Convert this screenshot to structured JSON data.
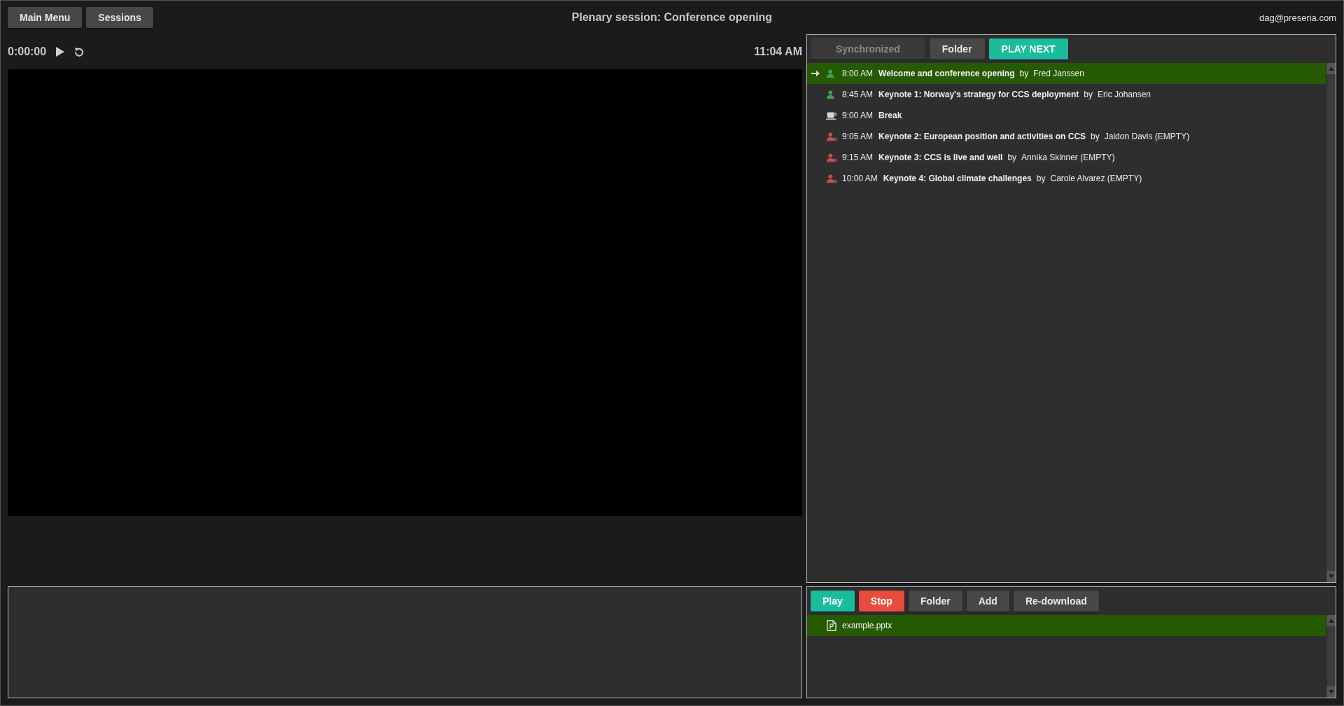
{
  "header": {
    "buttons": [
      "Main Menu",
      "Sessions"
    ],
    "title": "Plenary session: Conference opening",
    "user": "dag@preseria.com"
  },
  "player": {
    "time": "0:00:00",
    "clock": "11:04 AM"
  },
  "sessions": {
    "buttons": [
      {
        "label": "Synchronized",
        "kind": "normal",
        "disabled": true
      },
      {
        "label": "Folder",
        "kind": "normal",
        "disabled": false
      },
      {
        "label": "PLAY NEXT",
        "kind": "primary",
        "disabled": false
      }
    ],
    "items": [
      {
        "time": "8:00 AM",
        "title": "Welcome and conference opening",
        "by": "by",
        "presenter": "Fred Janssen",
        "kind": "speaker",
        "current": true,
        "selected": true
      },
      {
        "time": "8:45 AM",
        "title": "Keynote 1: Norway's strategy for CCS deployment",
        "by": "by",
        "presenter": "Eric Johansen",
        "kind": "speaker",
        "current": false,
        "selected": false
      },
      {
        "time": "9:00 AM",
        "title": "Break",
        "kind": "break",
        "current": false,
        "selected": false
      },
      {
        "time": "9:05 AM",
        "title": "Keynote 2: European position and activities on CCS",
        "by": "by",
        "presenter": "Jaidon Davis (EMPTY)",
        "kind": "empty",
        "current": false,
        "selected": false
      },
      {
        "time": "9:15 AM",
        "title": "Keynote 3: CCS is live and well",
        "by": "by",
        "presenter": "Annika Skinner (EMPTY)",
        "kind": "empty",
        "current": false,
        "selected": false
      },
      {
        "time": "10:00 AM",
        "title": "Keynote 4: Global climate challenges",
        "by": "by",
        "presenter": "Carole Alvarez (EMPTY)",
        "kind": "empty",
        "current": false,
        "selected": false
      }
    ]
  },
  "files": {
    "buttons": [
      {
        "label": "Play",
        "kind": "primary"
      },
      {
        "label": "Stop",
        "kind": "danger"
      },
      {
        "label": "Folder",
        "kind": "normal"
      },
      {
        "label": "Add",
        "kind": "normal"
      },
      {
        "label": "Re-download",
        "kind": "normal"
      }
    ],
    "items": [
      {
        "name": "example.pptx",
        "selected": true
      }
    ]
  }
}
